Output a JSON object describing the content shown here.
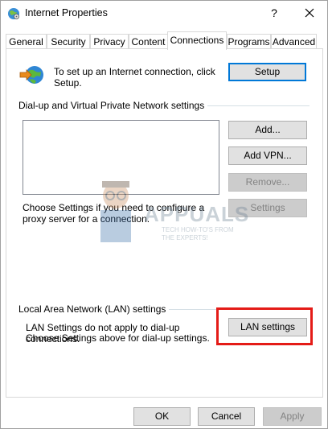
{
  "window": {
    "title": "Internet Properties",
    "help_glyph": "?",
    "icons": {
      "title": "internet-options-globe-icon",
      "close": "close-icon",
      "setup": "globe-connect-icon"
    }
  },
  "tabs": [
    {
      "label": "General"
    },
    {
      "label": "Security"
    },
    {
      "label": "Privacy"
    },
    {
      "label": "Content"
    },
    {
      "label": "Connections",
      "active": true
    },
    {
      "label": "Programs"
    },
    {
      "label": "Advanced"
    }
  ],
  "setup_section": {
    "text": "To set up an Internet connection, click Setup.",
    "button": "Setup"
  },
  "dialup_section": {
    "heading": "Dial-up and Virtual Private Network settings",
    "add_button": "Add...",
    "add_vpn_button": "Add VPN...",
    "remove_button": "Remove...",
    "settings_text": "Choose Settings if you need to configure a proxy server for a connection.",
    "settings_button": "Settings"
  },
  "lan_section": {
    "heading": "Local Area Network (LAN) settings",
    "text_line1": "LAN Settings do not apply to dial-up connections.",
    "text_line2": "Choose Settings above for dial-up settings.",
    "button": "LAN settings"
  },
  "footer": {
    "ok": "OK",
    "cancel": "Cancel",
    "apply": "Apply"
  },
  "watermark": {
    "brand": "APPUALS",
    "tagline_1": "TECH HOW-TO'S FROM",
    "tagline_2": "THE EXPERTS!"
  },
  "colors": {
    "highlight": "#e41b17",
    "focus_border": "#0078d7"
  }
}
